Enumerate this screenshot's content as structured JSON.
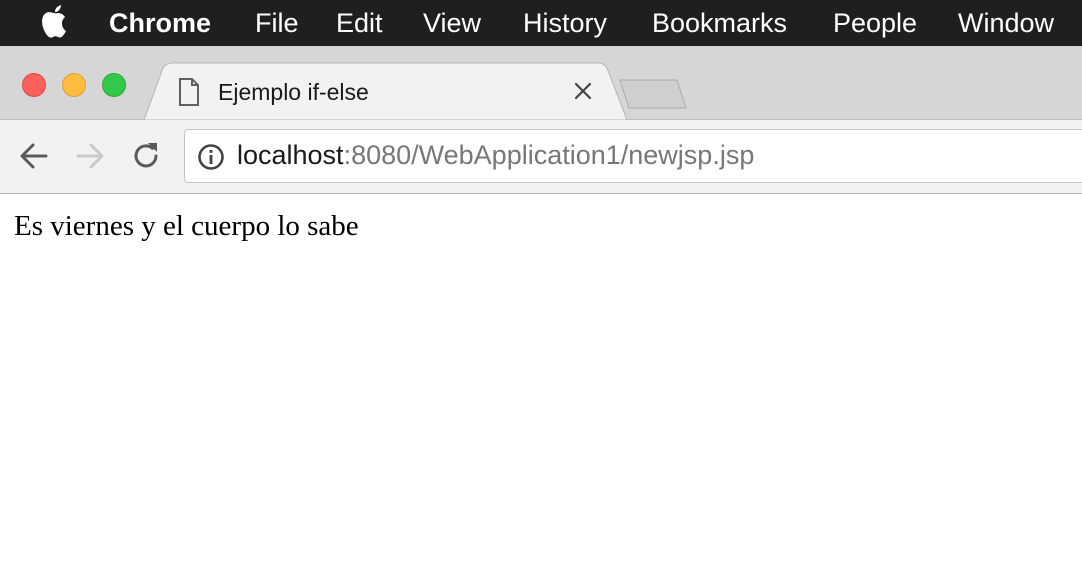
{
  "menubar": {
    "app_name": "Chrome",
    "items": [
      "File",
      "Edit",
      "View",
      "History",
      "Bookmarks",
      "People",
      "Window"
    ]
  },
  "tab": {
    "title": "Ejemplo if-else",
    "icon": "document-icon"
  },
  "address_bar": {
    "host": "localhost",
    "rest": ":8080/WebApplication1/newjsp.jsp"
  },
  "page": {
    "text": "Es viernes y el cuerpo lo sabe"
  },
  "colors": {
    "menubar": "#1f1f1f",
    "close_light": "#fc605c",
    "minimize_light": "#fdbc40",
    "maximize_light": "#34c84a"
  }
}
